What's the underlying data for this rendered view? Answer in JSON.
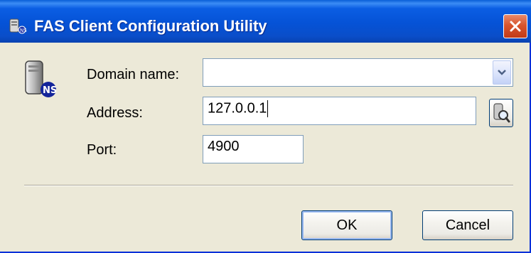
{
  "window": {
    "title": "FAS Client Configuration Utility",
    "icon": "server-icon",
    "close_icon": "close-icon"
  },
  "form": {
    "domain_label": "Domain name:",
    "domain_value": "",
    "address_label": "Address:",
    "address_value": "127.0.0.1",
    "port_label": "Port:",
    "port_value": "4900",
    "browse_icon": "browse-search-icon"
  },
  "buttons": {
    "ok_label": "OK",
    "cancel_label": "Cancel"
  },
  "colors": {
    "titlebar": "#0552d6",
    "dialog_bg": "#ece9d8",
    "close_button": "#d8552e"
  }
}
